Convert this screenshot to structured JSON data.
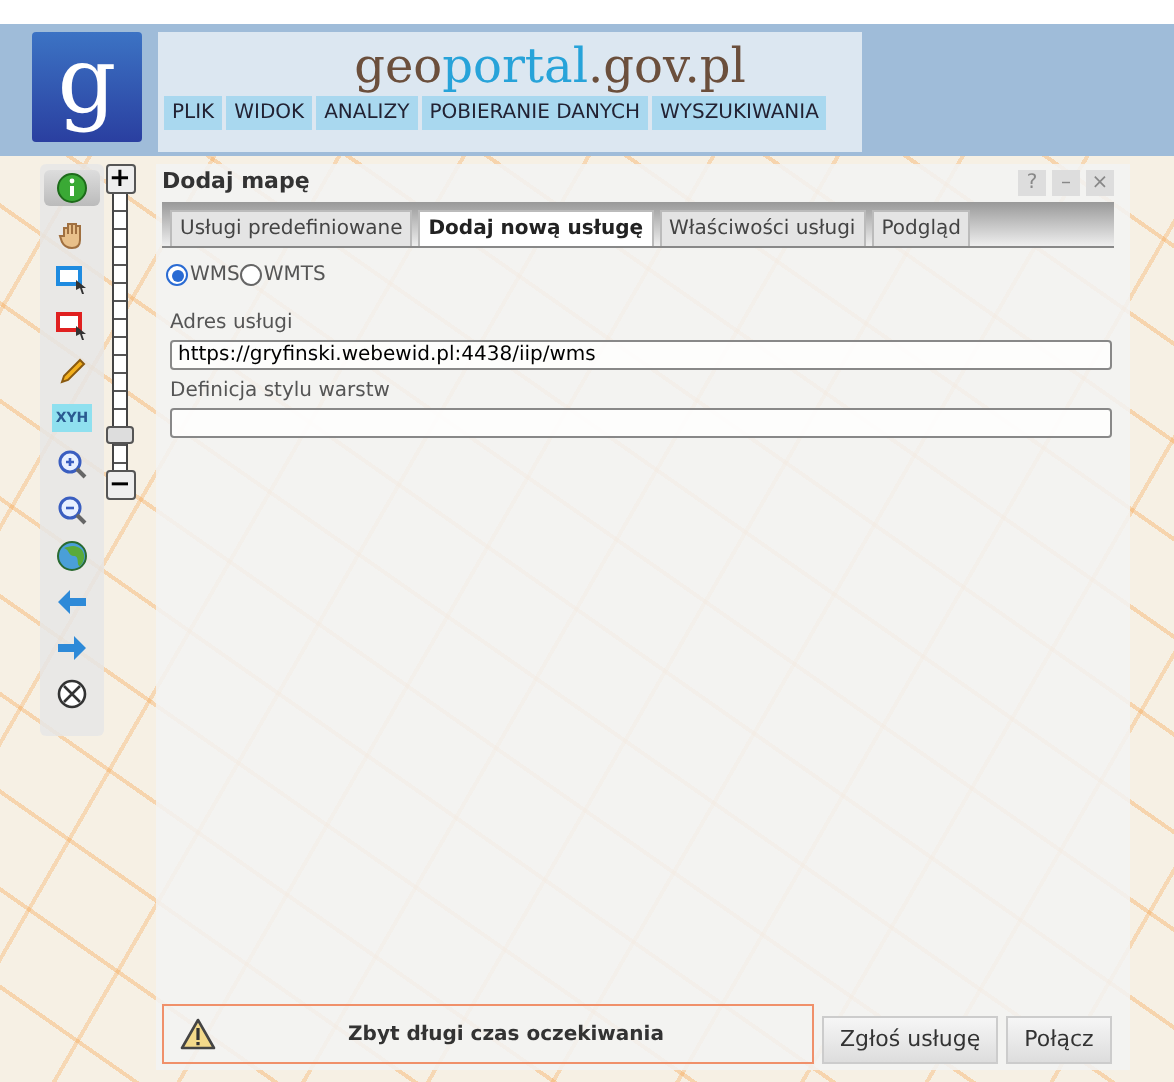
{
  "header": {
    "logo_letter": "g",
    "title_parts": [
      {
        "text": "geo",
        "kind": "dark"
      },
      {
        "text": "portal",
        "kind": "accent"
      },
      {
        "text": ".gov.pl",
        "kind": "dark"
      }
    ],
    "menu": [
      "PLIK",
      "WIDOK",
      "ANALIZY",
      "POBIERANIE DANYCH",
      "WYSZUKIWANIA"
    ]
  },
  "toolbar": [
    {
      "kind": "info",
      "selected": true
    },
    {
      "kind": "hand",
      "selected": false
    },
    {
      "kind": "select-blue",
      "selected": false
    },
    {
      "kind": "select-red",
      "selected": false
    },
    {
      "kind": "pencil",
      "selected": false
    },
    {
      "kind": "xyh",
      "label": "XYH",
      "selected": false
    },
    {
      "kind": "zoom-in",
      "selected": false
    },
    {
      "kind": "zoom-out",
      "selected": false
    },
    {
      "kind": "globe",
      "selected": false
    },
    {
      "kind": "back",
      "selected": false
    },
    {
      "kind": "forward",
      "selected": false
    },
    {
      "kind": "clear",
      "selected": false
    }
  ],
  "zoom": {
    "plus": "+",
    "minus": "−",
    "level": 0.1
  },
  "dialog": {
    "title": "Dodaj mapę",
    "controls": [
      "?",
      "–",
      "×"
    ],
    "tabs": [
      {
        "label": "Usługi predefiniowane",
        "selected": false
      },
      {
        "label": "Dodaj nową usługę",
        "selected": true
      },
      {
        "label": "Właściwości usługi",
        "selected": false
      },
      {
        "label": "Podgląd",
        "selected": false
      }
    ],
    "radios": [
      {
        "label": "WMS",
        "selected": true
      },
      {
        "label": "WMTS",
        "selected": false
      }
    ],
    "fields": [
      {
        "label": "Adres usługi",
        "value": "https://gryfinski.webewid.pl:4438/iip/wms"
      },
      {
        "label": "Definicja stylu warstw"
      }
    ],
    "warning": "Zbyt długi czas oczekiwania",
    "buttons": [
      "Zgłoś usługę",
      "Połącz"
    ]
  }
}
